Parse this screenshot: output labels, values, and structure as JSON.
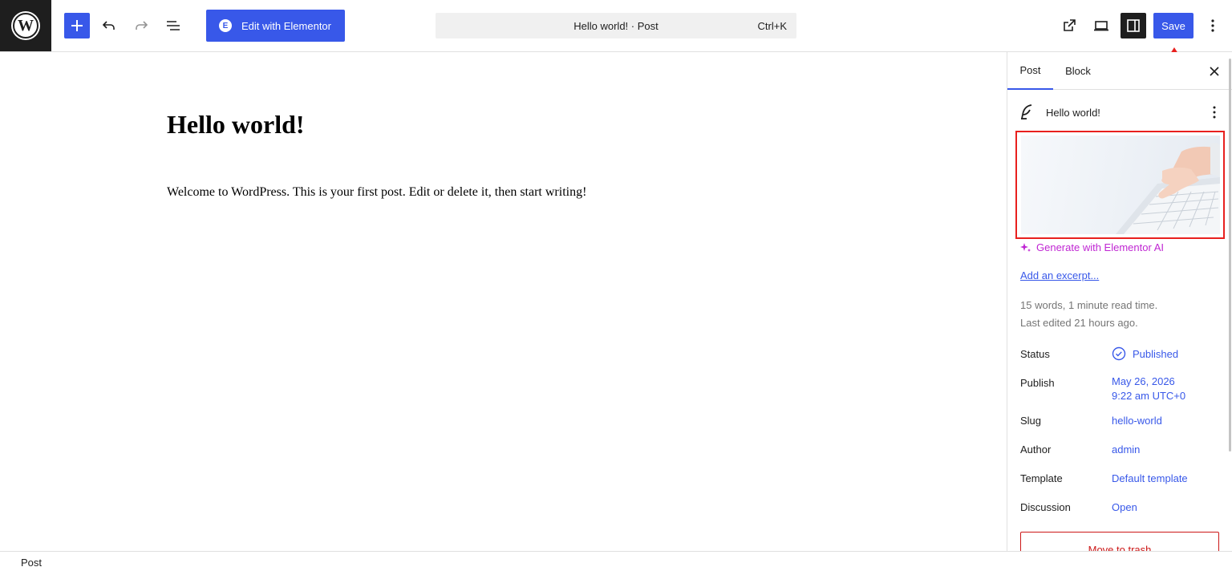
{
  "toolbar": {
    "elementor_label": "Edit with Elementor",
    "command_title": "Hello world! · Post",
    "command_shortcut": "Ctrl+K",
    "save_label": "Save",
    "icons": [
      "wordpress-logo",
      "plus-icon",
      "undo-icon",
      "redo-icon",
      "document-overview-icon",
      "elementor-icon",
      "view-post-icon",
      "preview-device-icon",
      "settings-sidebar-icon",
      "options-kebab-icon"
    ]
  },
  "editor": {
    "title": "Hello world!",
    "paragraph": "Welcome to WordPress. This is your first post. Edit or delete it, then start writing!"
  },
  "sidebar": {
    "tabs": [
      {
        "label": "Post",
        "active": true
      },
      {
        "label": "Block",
        "active": false
      }
    ],
    "post_title": "Hello world!",
    "generate_ai_label": "Generate with Elementor AI",
    "excerpt_link": "Add an excerpt...",
    "word_stats": "15 words, 1 minute read time.",
    "last_edited": "Last edited 21 hours ago.",
    "rows": [
      {
        "label": "Status",
        "value": "Published"
      },
      {
        "label": "Publish",
        "value": "May 26, 2026",
        "value2": "9:22 am UTC+0"
      },
      {
        "label": "Slug",
        "value": "hello-world"
      },
      {
        "label": "Author",
        "value": "admin"
      },
      {
        "label": "Template",
        "value": "Default template"
      },
      {
        "label": "Discussion",
        "value": "Open"
      }
    ],
    "trash_label": "Move to trash"
  },
  "footer": {
    "breadcrumb": "Post"
  },
  "colors": {
    "accent": "#3858e9",
    "ai": "#c026d3",
    "danger": "#cc1818",
    "annotation": "#e8201e"
  }
}
